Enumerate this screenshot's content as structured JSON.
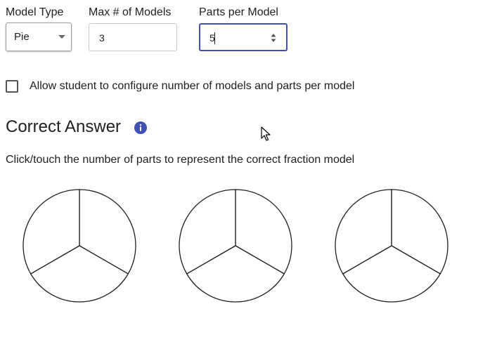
{
  "labels": {
    "model_type": "Model Type",
    "max_models": "Max # of Models",
    "parts_per_model": "Parts per Model"
  },
  "model_type": {
    "selected": "Pie"
  },
  "max_models": {
    "value": "3"
  },
  "parts_per_model": {
    "value": "5"
  },
  "configure_checkbox": {
    "label": "Allow student to configure number of models and parts per model",
    "checked": false
  },
  "correct_answer": {
    "title": "Correct Answer",
    "instructions": "Click/touch the number of parts to represent the correct fraction model"
  },
  "pies": {
    "count": 3,
    "parts_each": 3
  },
  "icons": {
    "info": "info-icon",
    "dropdown": "chevron-down-icon",
    "spinner": "spinner-arrows-icon",
    "cursor": "mouse-pointer-icon"
  },
  "colors": {
    "accent": "#3f51b5",
    "text": "#212121",
    "pie_stroke": "#212121"
  }
}
